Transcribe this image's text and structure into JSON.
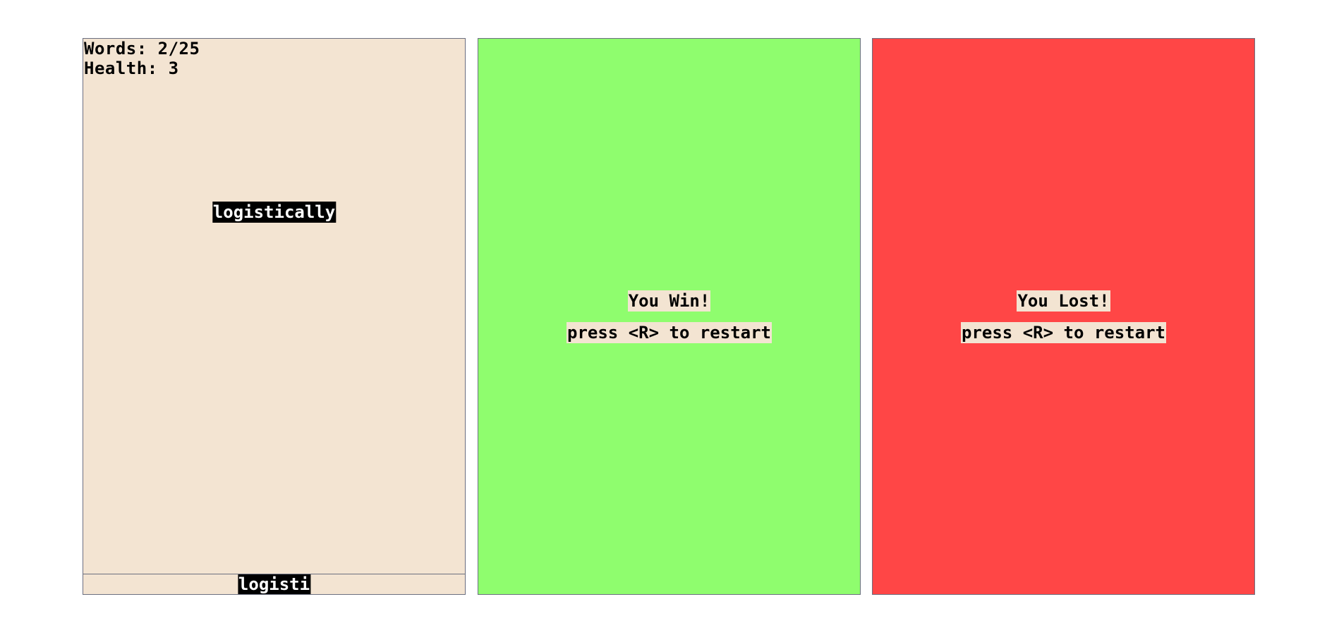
{
  "play_panel": {
    "words_label": "Words: 2/25",
    "health_label": "Health: 3",
    "current_word": "logistically",
    "typed_text": "logisti",
    "background_color": "#f3e4d2"
  },
  "win_panel": {
    "title": "You Win!",
    "restart_hint": "press <R> to restart",
    "background_color": "#8ffd6e"
  },
  "lose_panel": {
    "title": "You Lost!",
    "restart_hint": "press <R> to restart",
    "background_color": "#ff4646"
  }
}
